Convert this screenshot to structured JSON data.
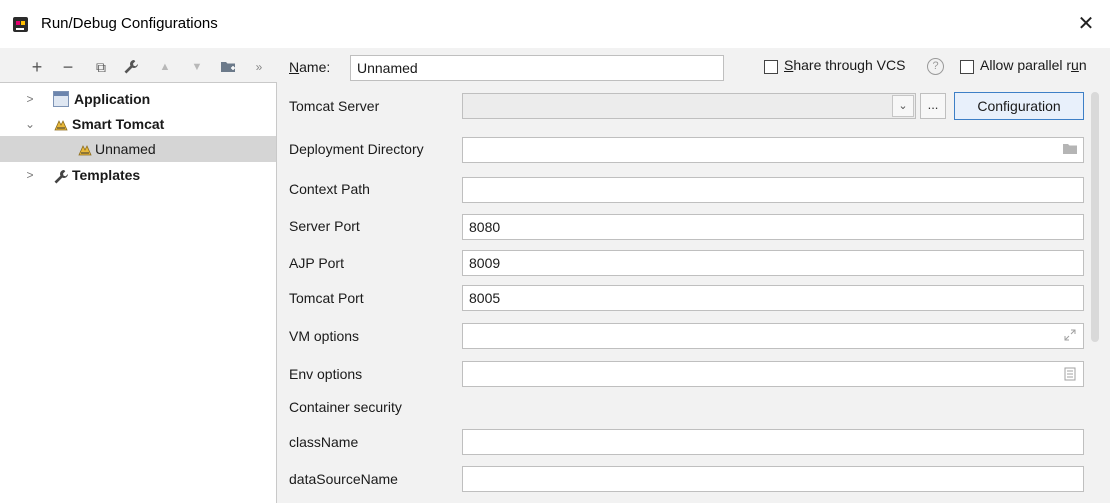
{
  "window": {
    "title": "Run/Debug Configurations",
    "close_glyph": "✕"
  },
  "toolbar": {
    "add": "+",
    "remove": "−",
    "copy": "⧉",
    "edit": "🔧",
    "up": "▲",
    "down": "▼",
    "folder": "▣",
    "more": "»"
  },
  "tree": {
    "items": [
      {
        "label": "Application",
        "icon": "application-window-icon",
        "expanded": false
      },
      {
        "label": "Smart Tomcat",
        "icon": "tomcat-icon",
        "expanded": true
      },
      {
        "label": "Unnamed",
        "icon": "tomcat-icon",
        "selected": true
      },
      {
        "label": "Templates",
        "icon": "wrench-icon",
        "expanded": false
      }
    ]
  },
  "form": {
    "name_label_first": "N",
    "name_label_rest": "ame:",
    "name_value": "Unnamed",
    "share_vcs_first": "S",
    "share_vcs_rest": "hare through VCS",
    "help_glyph": "?",
    "parallel_label_main": "Allow parallel r",
    "parallel_label_u": "u",
    "parallel_label_end": "n",
    "tomcat_server_label": "Tomcat Server",
    "tomcat_server_value": "",
    "ellipsis": "...",
    "configuration_button": "Configuration",
    "deployment_dir_label": "Deployment Directory",
    "deployment_dir_value": "",
    "context_path_label": "Context Path",
    "context_path_value": "",
    "server_port_label": "Server Port",
    "server_port_value": "8080",
    "ajp_port_label": "AJP Port",
    "ajp_port_value": "8009",
    "tomcat_port_label": "Tomcat Port",
    "tomcat_port_value": "8005",
    "vm_options_label": "VM options",
    "vm_options_value": "",
    "env_options_label": "Env options",
    "env_options_value": "",
    "container_security_label": "Container security",
    "classname_label": "className",
    "classname_value": "",
    "datasource_label": "dataSourceName",
    "datasource_value": ""
  }
}
